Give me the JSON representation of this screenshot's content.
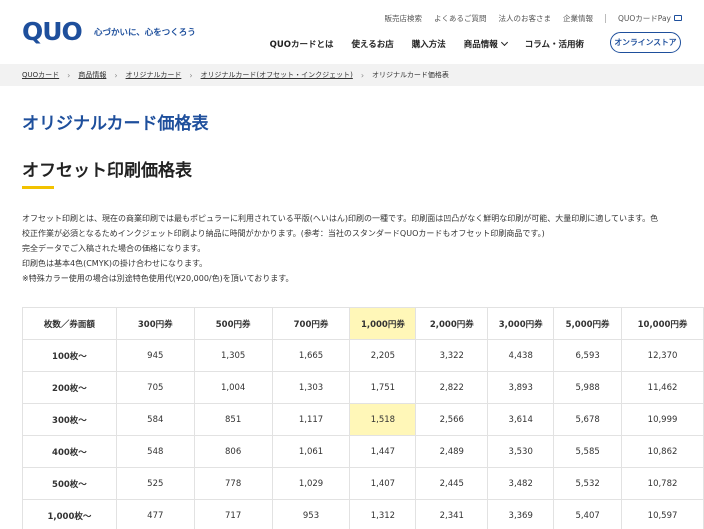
{
  "header": {
    "logo_text": "QUO",
    "tagline": "心づかいに、心をつくろう",
    "util_nav": [
      "販売店検索",
      "よくあるご質問",
      "法人のお客さま",
      "企業情報"
    ],
    "pay_link": "QUOカードPay",
    "main_nav": [
      "QUOカードとは",
      "使えるお店",
      "購入方法",
      "商品情報",
      "コラム・活用術"
    ],
    "store_button": "オンラインストア"
  },
  "breadcrumb": [
    "QUOカード",
    "商品情報",
    "オリジナルカード",
    "オリジナルカード(オフセット・インクジェット)",
    "オリジナルカード価格表"
  ],
  "page_title": "オリジナルカード価格表",
  "section_title": "オフセット印刷価格表",
  "description": [
    "オフセット印刷とは、現在の商業印刷では最もポピュラーに利用されている平版(へいはん)印刷の一種です。印刷面は凹凸がなく鮮明な印刷が可能、大量印刷に適しています。色",
    "校正作業が必須となるためインクジェット印刷より納品に時間がかかります。(参考：当社のスタンダードQUOカードもオフセット印刷商品です。)",
    "完全データでご入稿された場合の価格になります。",
    "印刷色は基本4色(CMYK)の掛け合わせになります。",
    "※特殊カラー使用の場合は別途特色使用代(¥20,000/色)を頂いております。"
  ],
  "table": {
    "corner": "枚数／券面額",
    "columns": [
      "300円券",
      "500円券",
      "700円券",
      "1,000円券",
      "2,000円券",
      "3,000円券",
      "5,000円券",
      "10,000円券"
    ],
    "highlight_column": 3,
    "highlight_row": 2,
    "highlight_color": "#fff7b8",
    "rows": [
      {
        "label": "100枚〜",
        "values": [
          "945",
          "1,305",
          "1,665",
          "2,205",
          "3,322",
          "4,438",
          "6,593",
          "12,370"
        ]
      },
      {
        "label": "200枚〜",
        "values": [
          "705",
          "1,004",
          "1,303",
          "1,751",
          "2,822",
          "3,893",
          "5,988",
          "11,462"
        ]
      },
      {
        "label": "300枚〜",
        "values": [
          "584",
          "851",
          "1,117",
          "1,518",
          "2,566",
          "3,614",
          "5,678",
          "10,999"
        ]
      },
      {
        "label": "400枚〜",
        "values": [
          "548",
          "806",
          "1,061",
          "1,447",
          "2,489",
          "3,530",
          "5,585",
          "10,862"
        ]
      },
      {
        "label": "500枚〜",
        "values": [
          "525",
          "778",
          "1,029",
          "1,407",
          "2,445",
          "3,482",
          "5,532",
          "10,782"
        ]
      },
      {
        "label": "1,000枚〜",
        "values": [
          "477",
          "717",
          "953",
          "1,312",
          "2,341",
          "3,369",
          "5,407",
          "10,597"
        ]
      }
    ]
  },
  "colors": {
    "brand_blue": "#1e4f9c",
    "accent_yellow": "#f2c200"
  }
}
